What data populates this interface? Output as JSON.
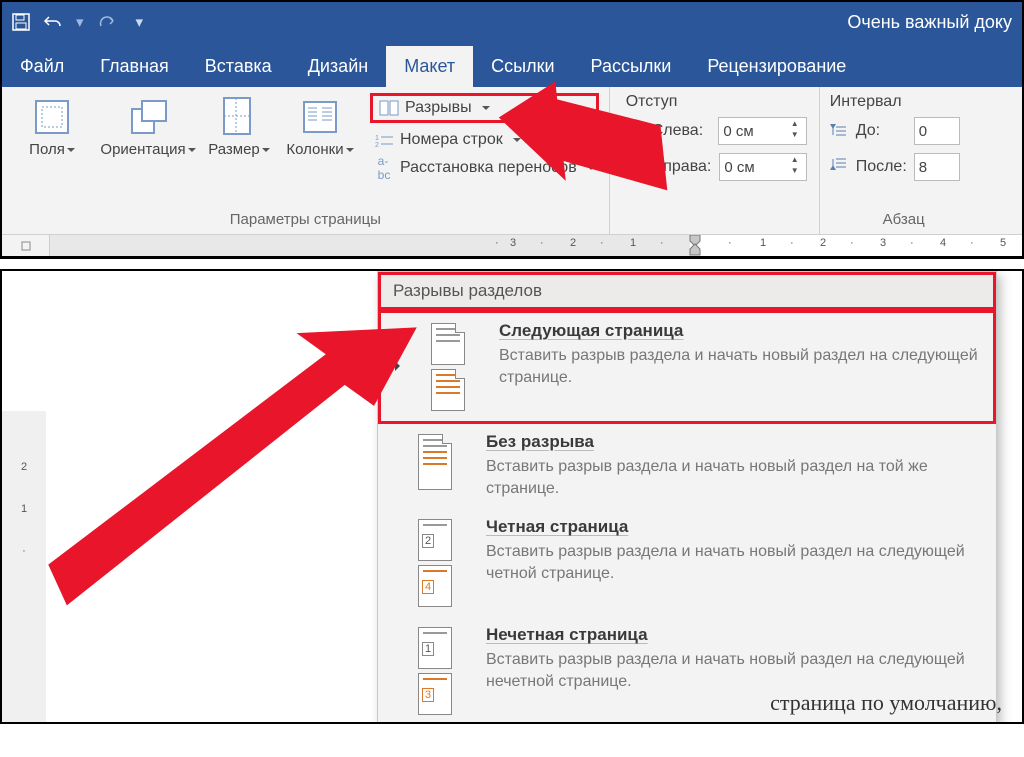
{
  "title": "Очень важный доку",
  "tabs": {
    "file": "Файл",
    "home": "Главная",
    "insert": "Вставка",
    "design": "Дизайн",
    "layout": "Макет",
    "references": "Ссылки",
    "mailings": "Рассылки",
    "review": "Рецензирование"
  },
  "ribbon": {
    "margins": "Поля",
    "orientation": "Ориентация",
    "size": "Размер",
    "columns": "Колонки",
    "breaks": "Разрывы",
    "line_numbers": "Номера строк",
    "hyphenation": "Расстановка переносов",
    "page_setup_group": "Параметры страницы",
    "indent_heading": "Отступ",
    "left_label": "Слева:",
    "right_label": "Справа:",
    "left_value": "0 см",
    "right_value": "0 см",
    "spacing_heading": "Интервал",
    "before_label": "До:",
    "after_label": "После:",
    "before_value": "0",
    "after_value": "8",
    "paragraph_group": "Абзац"
  },
  "ruler_numbers": [
    "3",
    "2",
    "1",
    "1",
    "2",
    "3",
    "4",
    "5"
  ],
  "dropdown": {
    "section_header": "Разрывы разделов",
    "items": [
      {
        "title": "Следующая страница",
        "desc": "Вставить разрыв раздела и начать новый раздел на следующей странице."
      },
      {
        "title": "Без разрыва",
        "desc": "Вставить разрыв раздела и начать новый раздел на той же странице."
      },
      {
        "title": "Четная страница",
        "desc": "Вставить разрыв раздела и начать новый раздел на следующей четной странице."
      },
      {
        "title": "Нечетная страница",
        "desc": "Вставить разрыв раздела и начать новый раздел на следующей нечетной странице."
      }
    ],
    "page_labels": {
      "two": "2",
      "four": "4",
      "one": "1",
      "three": "3"
    }
  },
  "doc_text": "страница по умолчанию,",
  "v_ruler": [
    "2",
    "1"
  ]
}
